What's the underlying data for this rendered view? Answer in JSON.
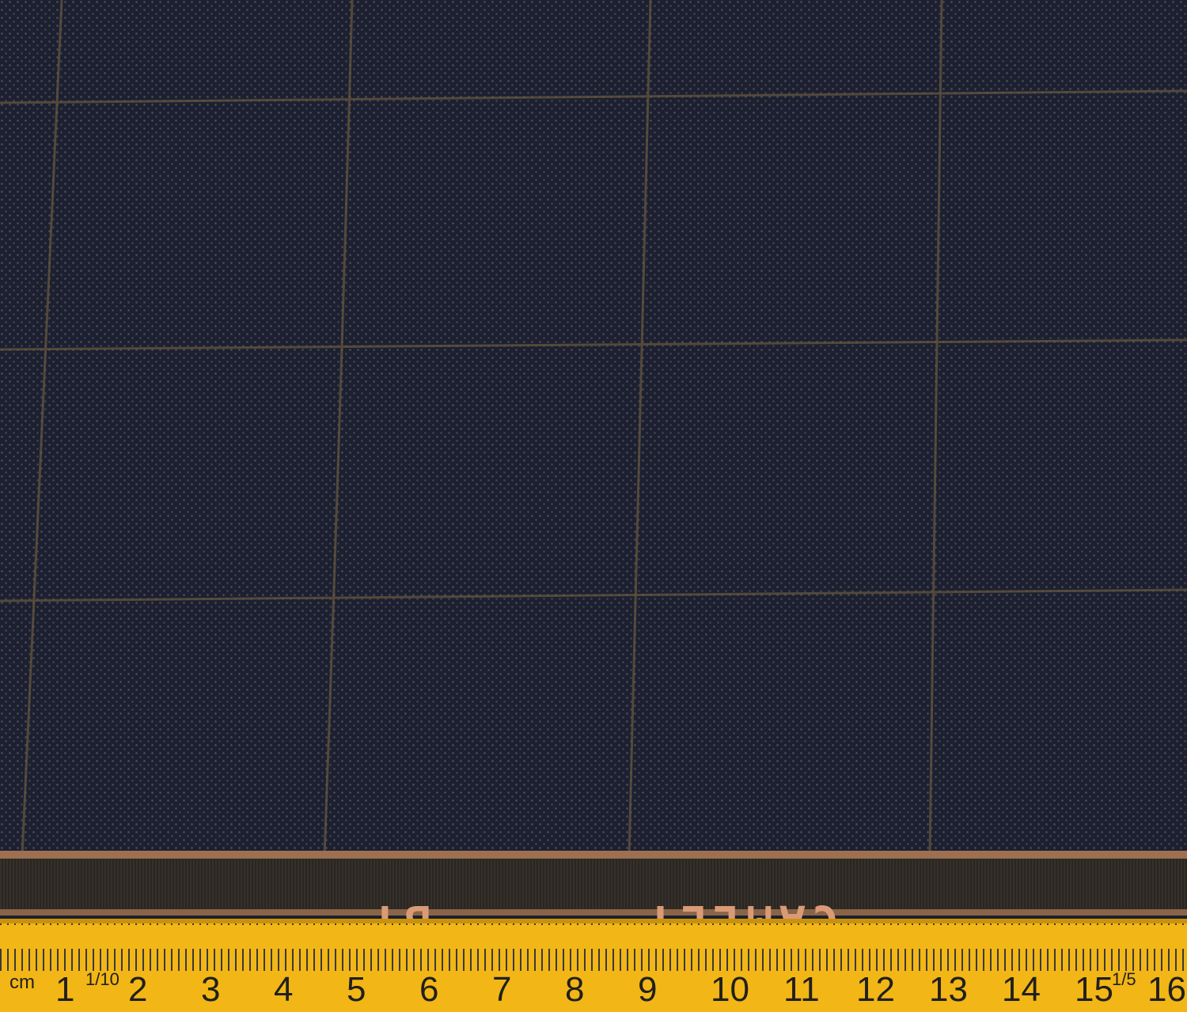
{
  "fabric": {
    "base_color": "#1f2435",
    "dot_color": "#6b6658",
    "windowpane_color": "#6b5a3e"
  },
  "selvedge": {
    "words": [
      "CAMLET",
      "BY"
    ],
    "text_color": "#d99b76",
    "band_color": "#2a2621"
  },
  "ruler": {
    "unit_label": "cm",
    "numbers": [
      "1",
      "2",
      "3",
      "4",
      "5",
      "6",
      "7",
      "8",
      "9",
      "10",
      "11",
      "12",
      "13",
      "14",
      "15",
      "16"
    ],
    "fractions": [
      "1/10",
      "1/5"
    ],
    "color": "#f2b616"
  }
}
